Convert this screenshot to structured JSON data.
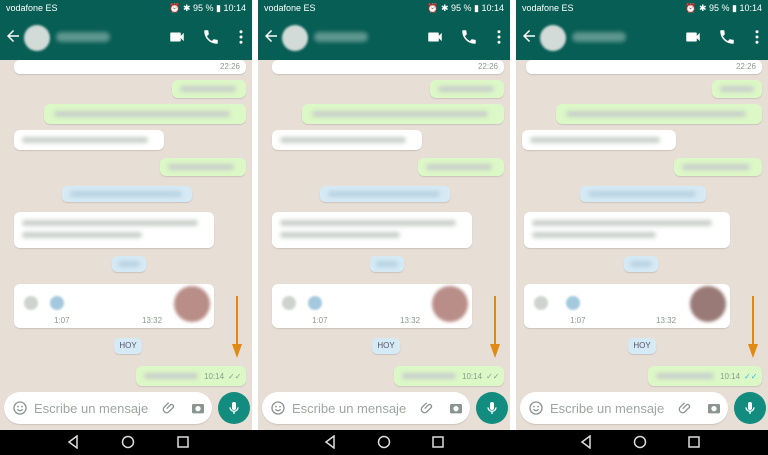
{
  "panels": [
    {
      "status": {
        "carrier": "vodafone ES",
        "battery": "95 %",
        "time": "10:14"
      },
      "chat": {
        "time_top": "22:26",
        "time_media_left": "1:07",
        "time_media_right": "13:32",
        "hoy_label": "HOY",
        "sent_time": "10:14",
        "sent_ticks": "✓✓"
      },
      "input": {
        "placeholder": "Escribe un mensaje"
      }
    },
    {
      "status": {
        "carrier": "vodafone ES",
        "battery": "95 %",
        "time": "10:14"
      },
      "chat": {
        "time_top": "22:26",
        "time_media_left": "1:07",
        "time_media_right": "13:32",
        "hoy_label": "HOY",
        "sent_time": "10:14",
        "sent_ticks": "✓✓"
      },
      "input": {
        "placeholder": "Escribe un mensaje"
      }
    },
    {
      "status": {
        "carrier": "vodafone ES",
        "battery": "95 %",
        "time": "10:14"
      },
      "chat": {
        "time_top": "22:26",
        "time_media_left": "1:07",
        "time_media_right": "13:32",
        "hoy_label": "HOY",
        "sent_time": "10:14",
        "sent_ticks": "✓✓"
      },
      "input": {
        "placeholder": "Escribe un mensaje"
      }
    }
  ],
  "colors": {
    "header": "#075e54",
    "outgoing": "#dcf8c6",
    "incoming": "#ffffff",
    "system": "#d6eaf5",
    "arrow": "#e08a14",
    "ticks_blue": "#34b7f1",
    "mic_button": "#128c7e"
  }
}
